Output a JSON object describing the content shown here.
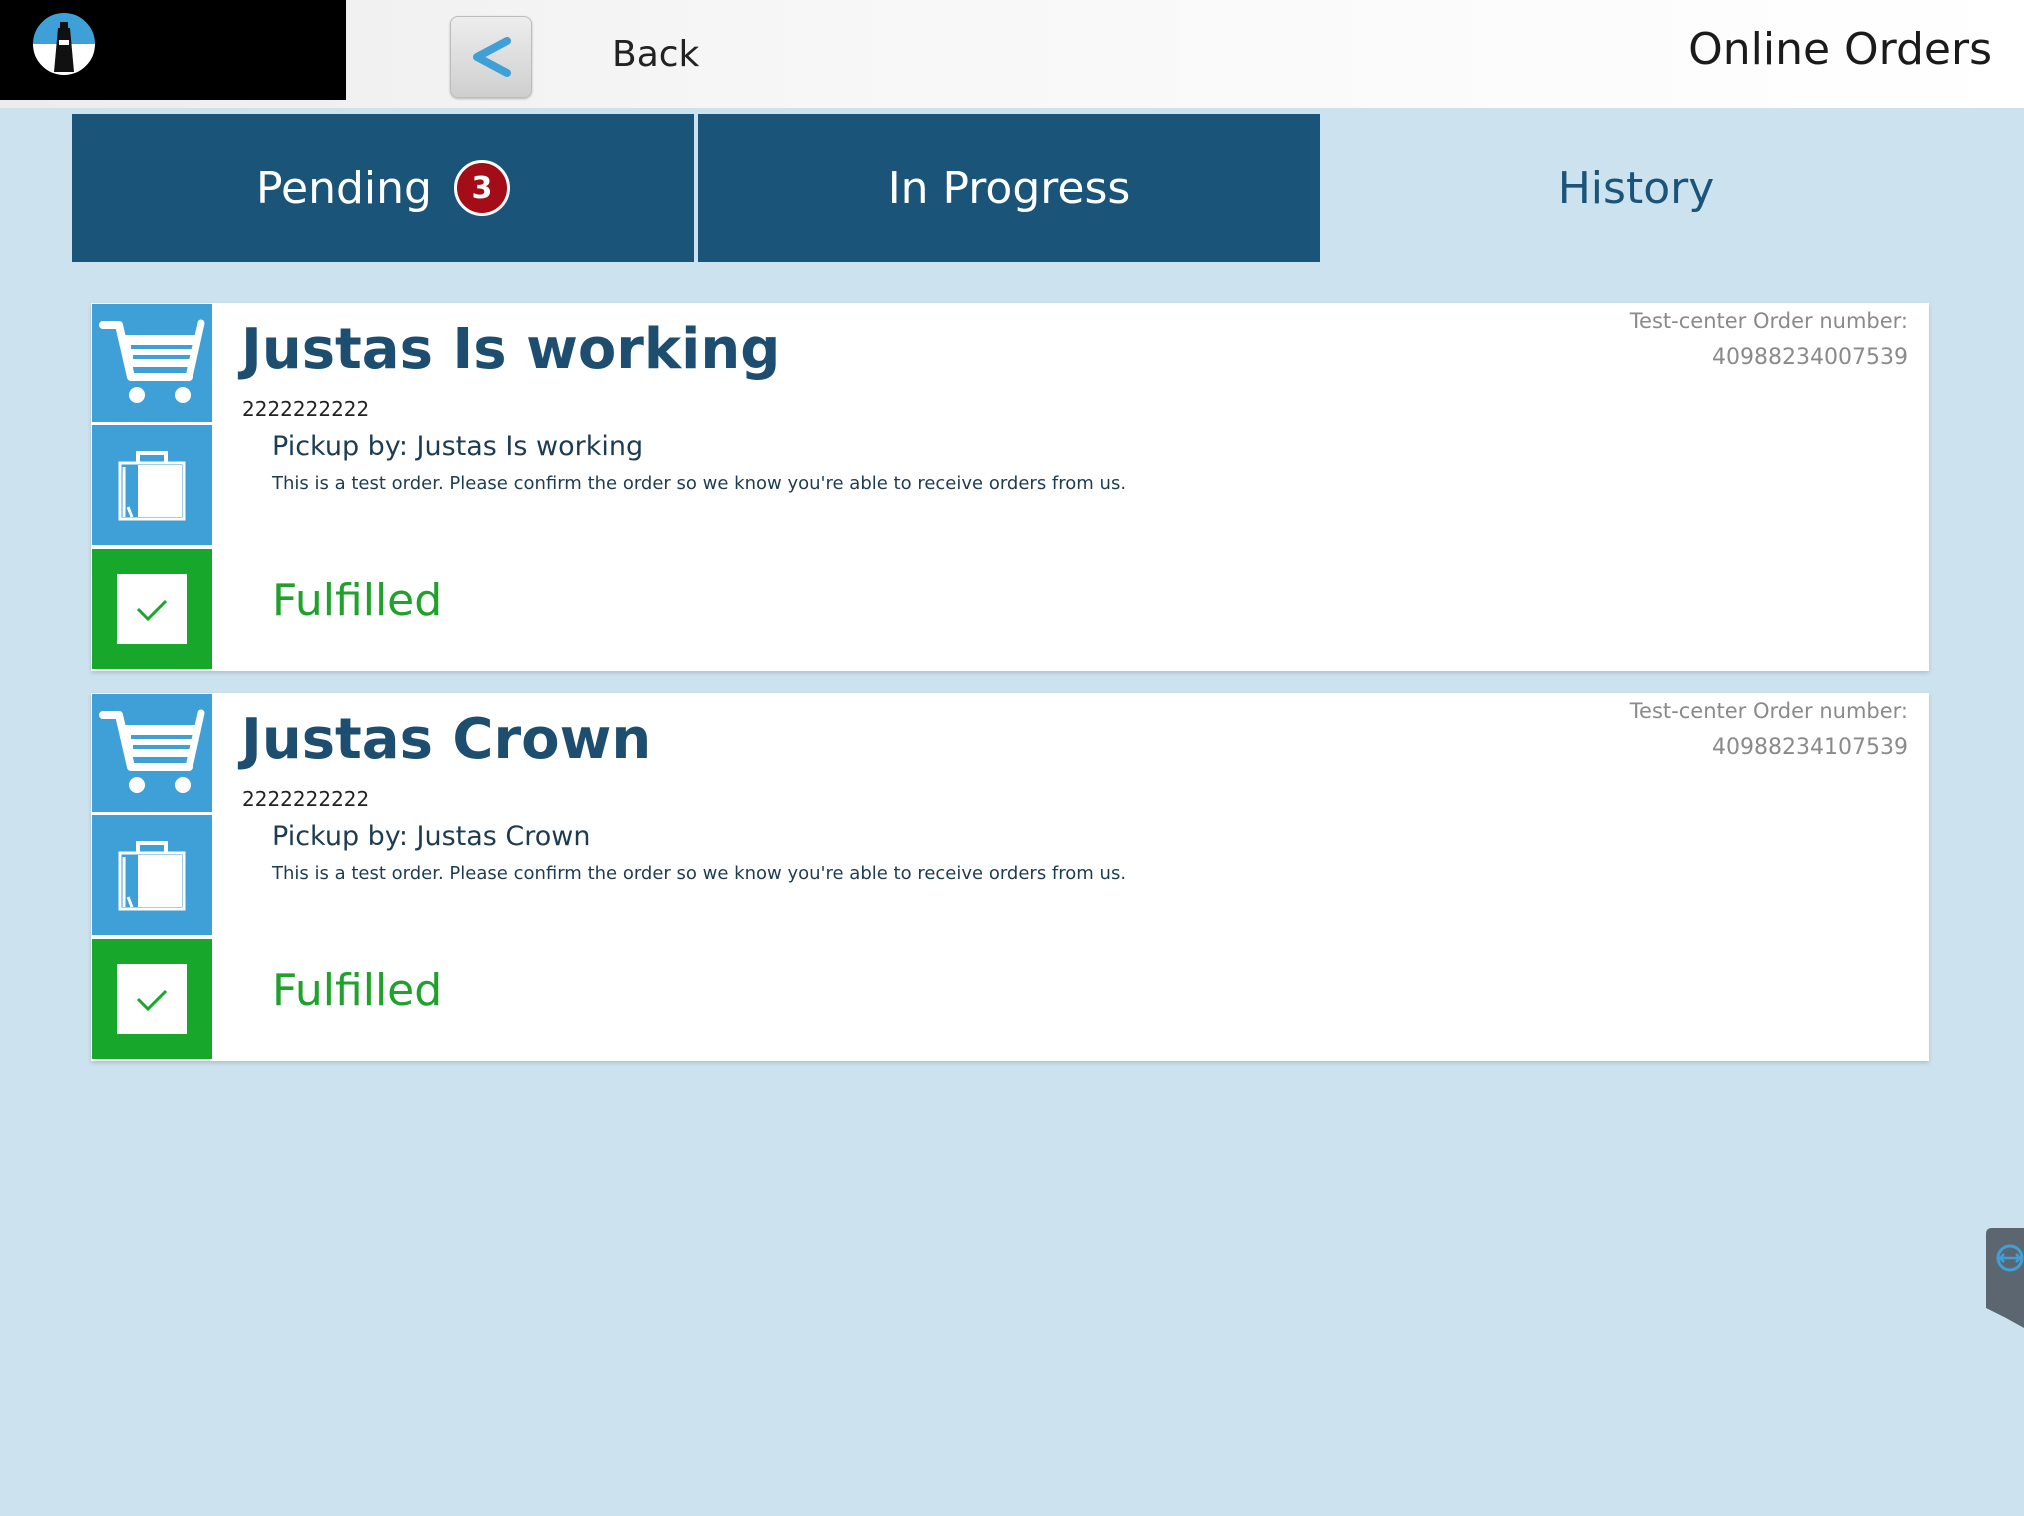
{
  "header": {
    "back_label": "Back",
    "title": "Online Orders"
  },
  "tabs": [
    {
      "label": "Pending",
      "badge": "3",
      "active": false
    },
    {
      "label": "In Progress",
      "active": false
    },
    {
      "label": "History",
      "active": true
    }
  ],
  "orders": [
    {
      "customer_name": "Justas Is working",
      "phone": "2222222222",
      "pickup": "Pickup by: Justas Is working",
      "note": "This is a test order. Please confirm the order so we know you're able to receive orders from us.",
      "status": "Fulfilled",
      "order_label": "Test-center Order number:",
      "order_number": "40988234007539"
    },
    {
      "customer_name": "Justas Crown",
      "phone": "2222222222",
      "pickup": "Pickup by: Justas Crown",
      "note": "This is a test order. Please confirm the order so we know you're able to receive orders from us.",
      "status": "Fulfilled",
      "order_label": "Test-center Order number:",
      "order_number": "40988234107539"
    }
  ],
  "icons": {
    "logo": "lighthouse-logo-icon",
    "back": "chevron-left-icon",
    "order_type": "cart-icon",
    "fulfillment": "shopping-bag-icon",
    "status": "checkmark-icon",
    "remote": "remote-support-icon"
  },
  "colors": {
    "background": "#cde2ef",
    "tab_dark": "#1b5479",
    "badge": "#a40d17",
    "tile_blue": "#3ea0d6",
    "status_green": "#16a72b",
    "name_text": "#1d4e6f"
  }
}
